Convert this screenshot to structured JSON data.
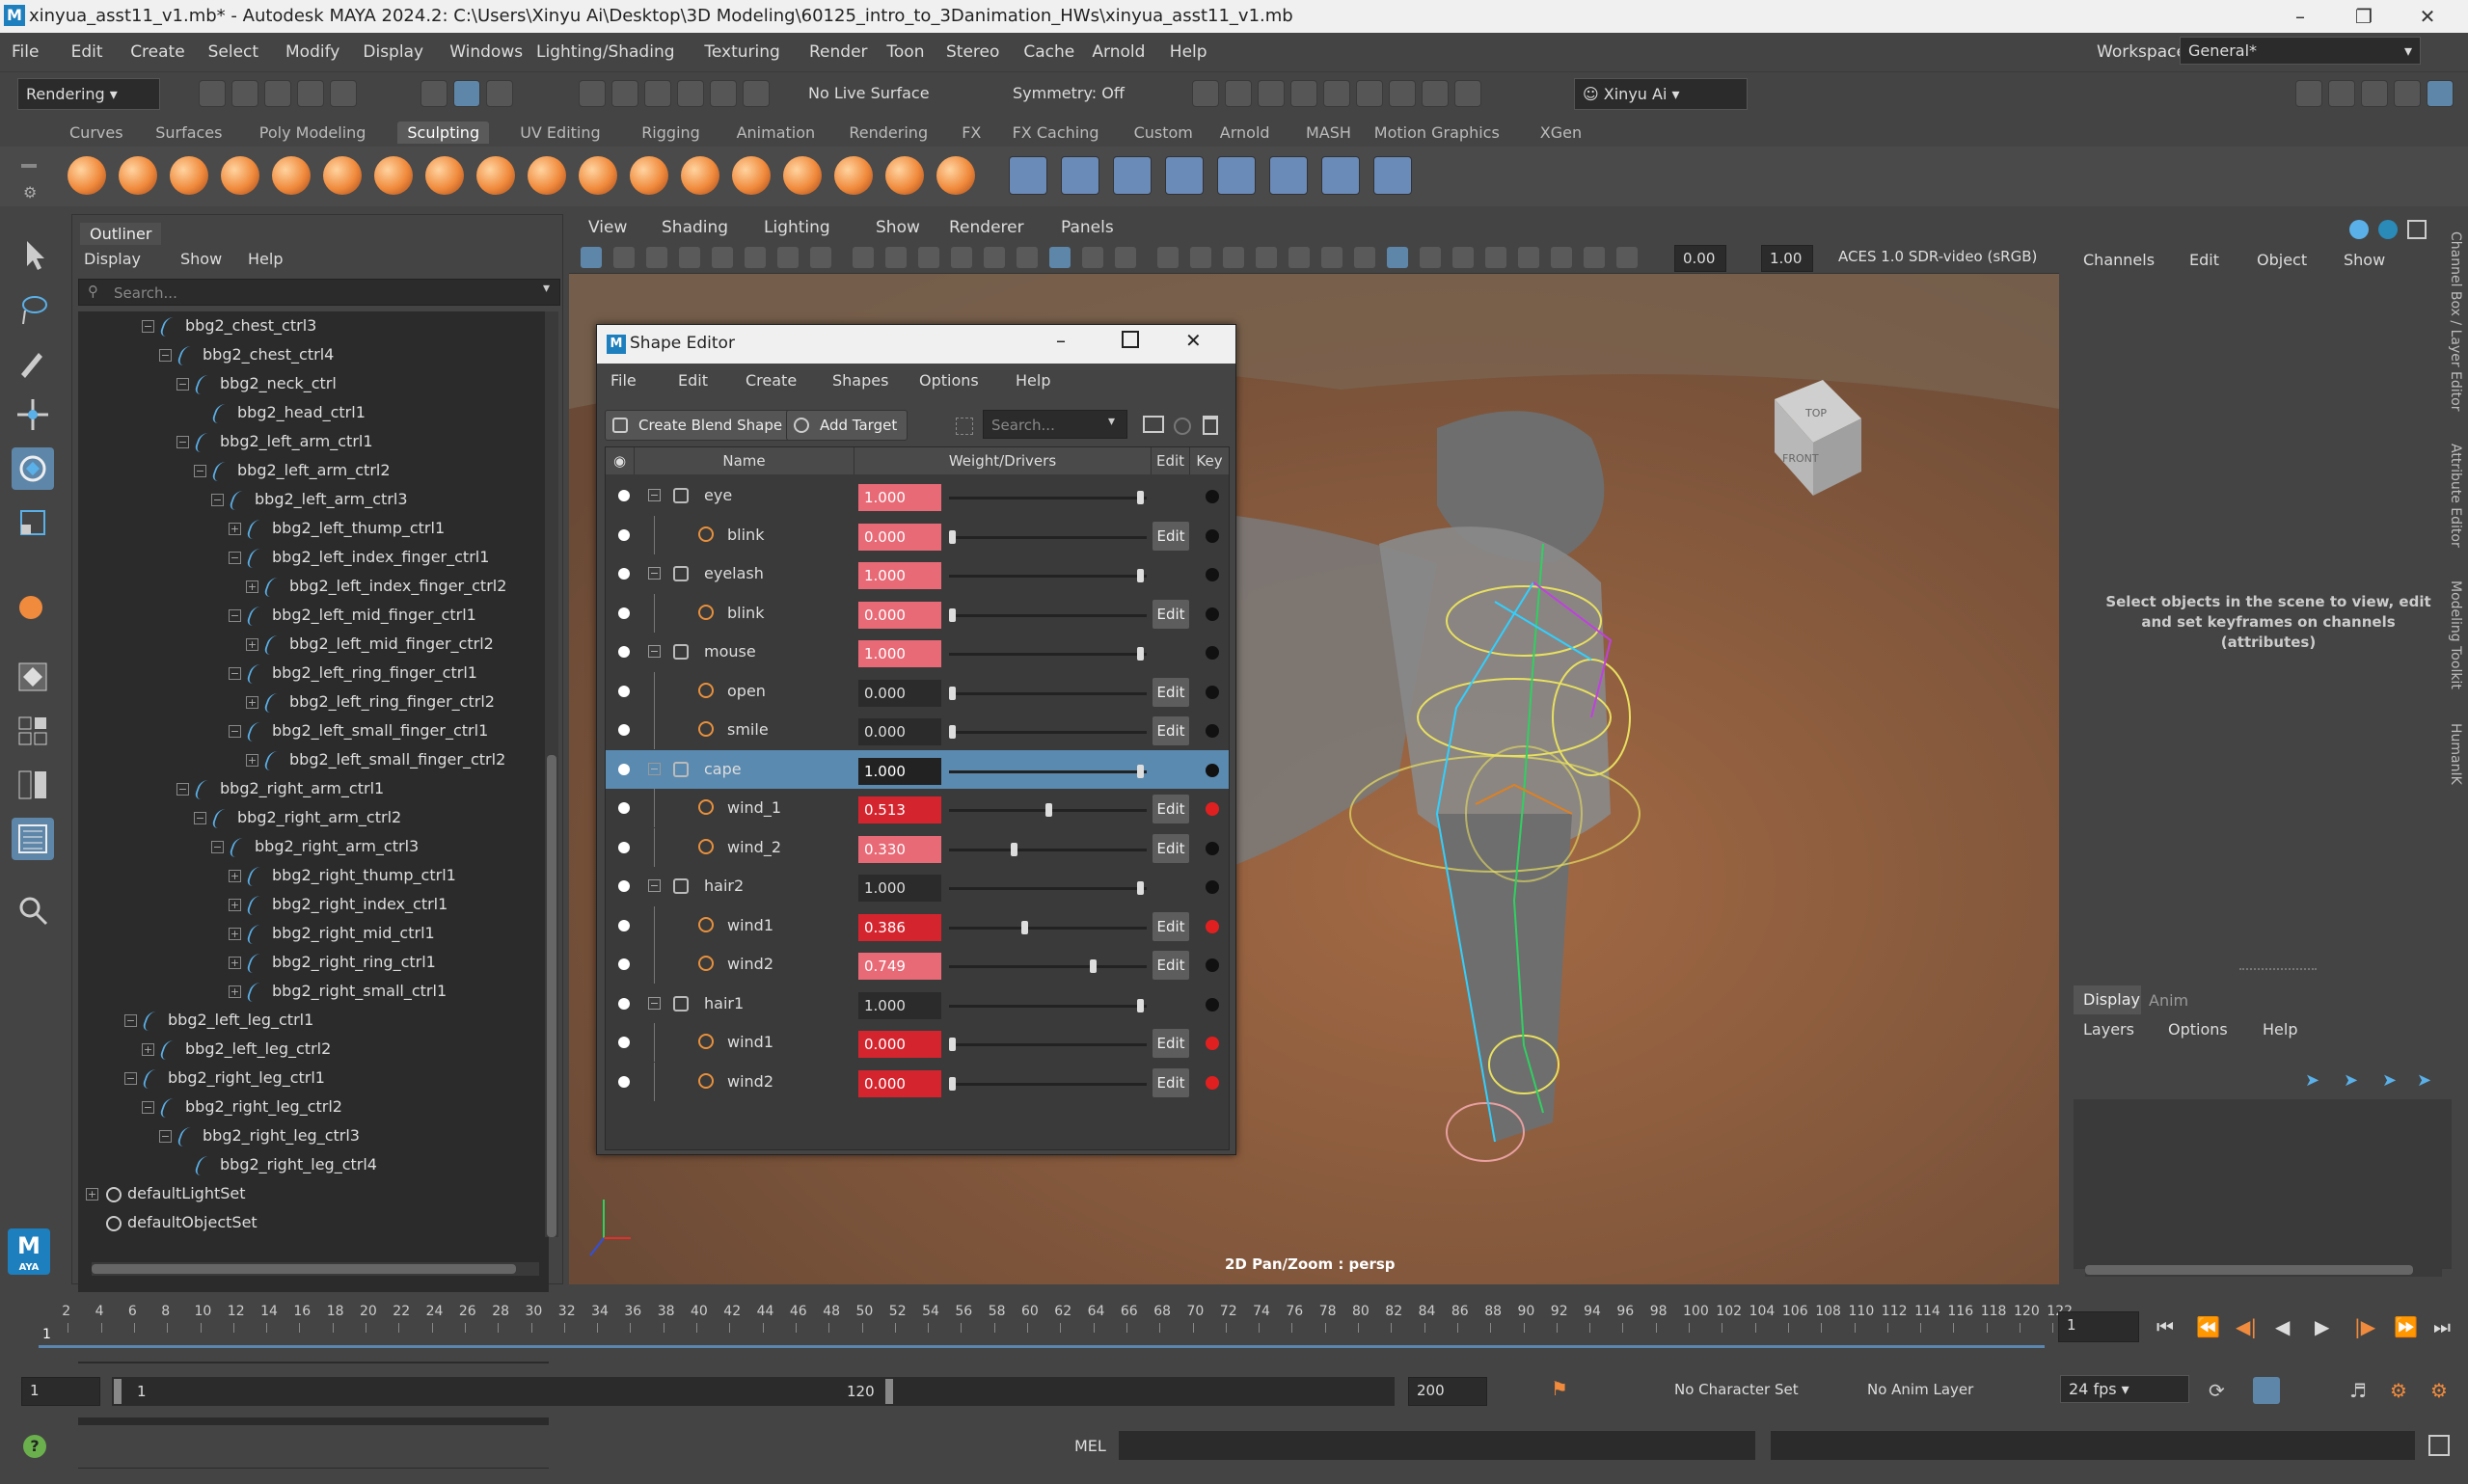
{
  "window": {
    "title": "xinyua_asst11_v1.mb* - Autodesk MAYA 2024.2: C:\\Users\\Xinyu Ai\\Desktop\\3D Modeling\\60125_intro_to_3Danimation_HWs\\xinyua_asst11_v1.mb"
  },
  "menubar": {
    "items": [
      "File",
      "Edit",
      "Create",
      "Select",
      "Modify",
      "Display",
      "Windows",
      "Lighting/Shading",
      "Texturing",
      "Render",
      "Toon",
      "Stereo",
      "Cache",
      "Arnold",
      "Help"
    ],
    "workspace_label": "Workspace:",
    "workspace_value": "General*"
  },
  "statusline": {
    "menuset": "Rendering",
    "live_surface": "No Live Surface",
    "symmetry": "Symmetry: Off",
    "user": "Xinyu Ai"
  },
  "shelf": {
    "tabs": [
      "Curves",
      "Surfaces",
      "Poly Modeling",
      "Sculpting",
      "UV Editing",
      "Rigging",
      "Animation",
      "Rendering",
      "FX",
      "FX Caching",
      "Custom",
      "Arnold",
      "MASH",
      "Motion Graphics",
      "XGen"
    ],
    "active_tab": "Sculpting"
  },
  "outliner": {
    "title": "Outliner",
    "menu": [
      "Display",
      "Show",
      "Help"
    ],
    "search_placeholder": "Search...",
    "nodes": [
      {
        "label": "bbg2_chest_ctrl3",
        "depth": 2,
        "exp": "-"
      },
      {
        "label": "bbg2_chest_ctrl4",
        "depth": 3,
        "exp": "-"
      },
      {
        "label": "bbg2_neck_ctrl",
        "depth": 4,
        "exp": "-"
      },
      {
        "label": "bbg2_head_ctrl1",
        "depth": 5,
        "exp": ""
      },
      {
        "label": "bbg2_left_arm_ctrl1",
        "depth": 4,
        "exp": "-"
      },
      {
        "label": "bbg2_left_arm_ctrl2",
        "depth": 5,
        "exp": "-"
      },
      {
        "label": "bbg2_left_arm_ctrl3",
        "depth": 6,
        "exp": "-"
      },
      {
        "label": "bbg2_left_thump_ctrl1",
        "depth": 7,
        "exp": "+"
      },
      {
        "label": "bbg2_left_index_finger_ctrl1",
        "depth": 7,
        "exp": "-"
      },
      {
        "label": "bbg2_left_index_finger_ctrl2",
        "depth": 8,
        "exp": "+"
      },
      {
        "label": "bbg2_left_mid_finger_ctrl1",
        "depth": 7,
        "exp": "-"
      },
      {
        "label": "bbg2_left_mid_finger_ctrl2",
        "depth": 8,
        "exp": "+"
      },
      {
        "label": "bbg2_left_ring_finger_ctrl1",
        "depth": 7,
        "exp": "-"
      },
      {
        "label": "bbg2_left_ring_finger_ctrl2",
        "depth": 8,
        "exp": "+"
      },
      {
        "label": "bbg2_left_small_finger_ctrl1",
        "depth": 7,
        "exp": "-"
      },
      {
        "label": "bbg2_left_small_finger_ctrl2",
        "depth": 8,
        "exp": "+"
      },
      {
        "label": "bbg2_right_arm_ctrl1",
        "depth": 4,
        "exp": "-"
      },
      {
        "label": "bbg2_right_arm_ctrl2",
        "depth": 5,
        "exp": "-"
      },
      {
        "label": "bbg2_right_arm_ctrl3",
        "depth": 6,
        "exp": "-"
      },
      {
        "label": "bbg2_right_thump_ctrl1",
        "depth": 7,
        "exp": "+"
      },
      {
        "label": "bbg2_right_index_ctrl1",
        "depth": 7,
        "exp": "+"
      },
      {
        "label": "bbg2_right_mid_ctrl1",
        "depth": 7,
        "exp": "+"
      },
      {
        "label": "bbg2_right_ring_ctrl1",
        "depth": 7,
        "exp": "+"
      },
      {
        "label": "bbg2_right_small_ctrl1",
        "depth": 7,
        "exp": "+"
      },
      {
        "label": "bbg2_left_leg_ctrl1",
        "depth": 1,
        "exp": "-"
      },
      {
        "label": "bbg2_left_leg_ctrl2",
        "depth": 2,
        "exp": "+"
      },
      {
        "label": "bbg2_right_leg_ctrl1",
        "depth": 1,
        "exp": "-"
      },
      {
        "label": "bbg2_right_leg_ctrl2",
        "depth": 2,
        "exp": "-"
      },
      {
        "label": "bbg2_right_leg_ctrl3",
        "depth": 3,
        "exp": "-"
      },
      {
        "label": "bbg2_right_leg_ctrl4",
        "depth": 4,
        "exp": ""
      },
      {
        "label": "defaultLightSet",
        "depth": -1,
        "exp": "+"
      },
      {
        "label": "defaultObjectSet",
        "depth": -1,
        "exp": ""
      }
    ]
  },
  "viewport": {
    "menu": [
      "View",
      "Shading",
      "Lighting",
      "Show",
      "Renderer",
      "Panels"
    ],
    "near": "0.00",
    "far": "1.00",
    "colorspace": "ACES 1.0 SDR-video (sRGB)",
    "status": "2D Pan/Zoom : persp",
    "cube_top": "TOP",
    "cube_front": "FRONT"
  },
  "shape_editor": {
    "title": "Shape Editor",
    "menu": [
      "File",
      "Edit",
      "Create",
      "Shapes",
      "Options",
      "Help"
    ],
    "create_label": "Create Blend Shape",
    "add_target_label": "Add Target",
    "search_placeholder": "Search...",
    "columns": [
      "Name",
      "Weight/Drivers",
      "Edit",
      "Key"
    ],
    "rows": [
      {
        "name": "eye",
        "kind": "group",
        "weight": "1.000",
        "level": 1.0,
        "style": "pink",
        "edit": false,
        "key": "black"
      },
      {
        "name": "blink",
        "kind": "target",
        "weight": "0.000",
        "level": 0.0,
        "style": "pink",
        "edit": true,
        "key": "black"
      },
      {
        "name": "eyelash",
        "kind": "group",
        "weight": "1.000",
        "level": 1.0,
        "style": "pink",
        "edit": false,
        "key": "black"
      },
      {
        "name": "blink",
        "kind": "target",
        "weight": "0.000",
        "level": 0.0,
        "style": "pink",
        "edit": true,
        "key": "black"
      },
      {
        "name": "mouse",
        "kind": "group",
        "weight": "1.000",
        "level": 1.0,
        "style": "pink",
        "edit": false,
        "key": "black"
      },
      {
        "name": "open",
        "kind": "target",
        "weight": "0.000",
        "level": 0.0,
        "style": "",
        "edit": true,
        "key": "black"
      },
      {
        "name": "smile",
        "kind": "target",
        "weight": "0.000",
        "level": 0.0,
        "style": "",
        "edit": true,
        "key": "black"
      },
      {
        "name": "cape",
        "kind": "group",
        "weight": "1.000",
        "level": 1.0,
        "style": "",
        "edit": false,
        "key": "black",
        "selected": true
      },
      {
        "name": "wind_1",
        "kind": "target",
        "weight": "0.513",
        "level": 0.513,
        "style": "red",
        "edit": true,
        "key": "red"
      },
      {
        "name": "wind_2",
        "kind": "target",
        "weight": "0.330",
        "level": 0.33,
        "style": "pink",
        "edit": true,
        "key": "black"
      },
      {
        "name": "hair2",
        "kind": "group",
        "weight": "1.000",
        "level": 1.0,
        "style": "",
        "edit": false,
        "key": "black"
      },
      {
        "name": "wind1",
        "kind": "target",
        "weight": "0.386",
        "level": 0.386,
        "style": "red",
        "edit": true,
        "key": "red"
      },
      {
        "name": "wind2",
        "kind": "target",
        "weight": "0.749",
        "level": 0.749,
        "style": "pink",
        "edit": true,
        "key": "black"
      },
      {
        "name": "hair1",
        "kind": "group",
        "weight": "1.000",
        "level": 1.0,
        "style": "",
        "edit": false,
        "key": "black"
      },
      {
        "name": "wind1",
        "kind": "target",
        "weight": "0.000",
        "level": 0.0,
        "style": "red",
        "edit": true,
        "key": "red"
      },
      {
        "name": "wind2",
        "kind": "target",
        "weight": "0.000",
        "level": 0.0,
        "style": "red",
        "edit": true,
        "key": "red"
      }
    ],
    "edit_label": "Edit"
  },
  "channel_box": {
    "menu": [
      "Channels",
      "Edit",
      "Object",
      "Show"
    ],
    "message": "Select objects in the scene to view, edit and set keyframes on channels (attributes)",
    "tabs": [
      "Display",
      "Anim"
    ],
    "layer_menu": [
      "Layers",
      "Options",
      "Help"
    ],
    "side_tabs": [
      "Channel Box / Layer Editor",
      "Attribute Editor",
      "Modeling Toolkit",
      "HumanIK"
    ]
  },
  "timeline": {
    "ticks": [
      "2",
      "4",
      "6",
      "8",
      "10",
      "12",
      "14",
      "16",
      "18",
      "20",
      "22",
      "24",
      "26",
      "28",
      "30",
      "32",
      "34",
      "36",
      "38",
      "40",
      "42",
      "44",
      "46",
      "48",
      "50",
      "52",
      "54",
      "56",
      "58",
      "60",
      "62",
      "64",
      "66",
      "68",
      "70",
      "72",
      "74",
      "76",
      "78",
      "80",
      "82",
      "84",
      "86",
      "88",
      "90",
      "92",
      "94",
      "96",
      "98",
      "100",
      "102",
      "104",
      "106",
      "108",
      "110",
      "112",
      "114",
      "116",
      "118",
      "120",
      "122"
    ],
    "current_marker": "1",
    "current_frame": "1"
  },
  "range": {
    "start": "1",
    "range_start": "1",
    "range_end": "120",
    "end": "200",
    "character_set": "No Character Set",
    "anim_layer": "No Anim Layer",
    "fps": "24 fps"
  },
  "cmdline": {
    "label": "MEL"
  }
}
